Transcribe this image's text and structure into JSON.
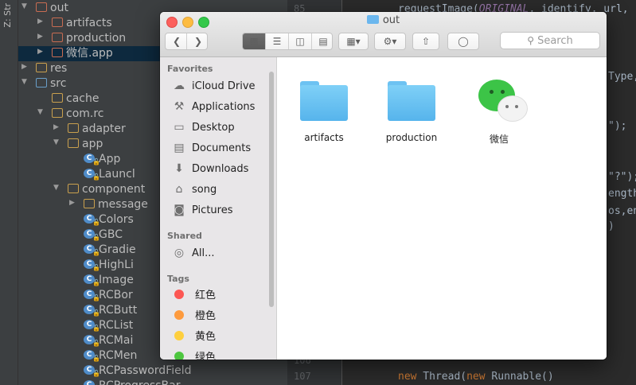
{
  "ide": {
    "side_label": "Z: Str",
    "tree": [
      {
        "label": "out",
        "depth": 1,
        "arrow": "▼",
        "icon": "folder-red"
      },
      {
        "label": "artifacts",
        "depth": 2,
        "arrow": "▶",
        "icon": "folder-red"
      },
      {
        "label": "production",
        "depth": 2,
        "arrow": "▶",
        "icon": "folder-red"
      },
      {
        "label": "微信.app",
        "depth": 2,
        "arrow": "▶",
        "icon": "folder-red",
        "selected": true
      },
      {
        "label": "res",
        "depth": 1,
        "arrow": "▶",
        "icon": "folder-res"
      },
      {
        "label": "src",
        "depth": 1,
        "arrow": "▼",
        "icon": "folder-blue"
      },
      {
        "label": "cache",
        "depth": 2,
        "arrow": "",
        "icon": "folder"
      },
      {
        "label": "com.rc",
        "depth": 2,
        "arrow": "▼",
        "icon": "folder"
      },
      {
        "label": "adapter",
        "depth": 3,
        "arrow": "▶",
        "icon": "folder"
      },
      {
        "label": "app",
        "depth": 3,
        "arrow": "▼",
        "icon": "folder"
      },
      {
        "label": "App",
        "depth": 4,
        "arrow": "",
        "icon": "class"
      },
      {
        "label": "Launcl",
        "depth": 4,
        "arrow": "",
        "icon": "class"
      },
      {
        "label": "component",
        "depth": 3,
        "arrow": "▼",
        "icon": "folder"
      },
      {
        "label": "message",
        "depth": 4,
        "arrow": "▶",
        "icon": "folder"
      },
      {
        "label": "Colors",
        "depth": 4,
        "arrow": "",
        "icon": "class"
      },
      {
        "label": "GBC",
        "depth": 4,
        "arrow": "",
        "icon": "class"
      },
      {
        "label": "Gradie",
        "depth": 4,
        "arrow": "",
        "icon": "class"
      },
      {
        "label": "HighLi",
        "depth": 4,
        "arrow": "",
        "icon": "class"
      },
      {
        "label": "Image",
        "depth": 4,
        "arrow": "",
        "icon": "class"
      },
      {
        "label": "RCBor",
        "depth": 4,
        "arrow": "",
        "icon": "class"
      },
      {
        "label": "RCButt",
        "depth": 4,
        "arrow": "",
        "icon": "class"
      },
      {
        "label": "RCList",
        "depth": 4,
        "arrow": "",
        "icon": "class"
      },
      {
        "label": "RCMai",
        "depth": 4,
        "arrow": "",
        "icon": "class"
      },
      {
        "label": "RCMen",
        "depth": 4,
        "arrow": "",
        "icon": "class"
      },
      {
        "label": "RCPasswordField",
        "depth": 4,
        "arrow": "",
        "icon": "class"
      },
      {
        "label": "RCProgressBar",
        "depth": 4,
        "arrow": "",
        "icon": "class"
      }
    ],
    "line_numbers": [
      "85",
      "106",
      "107"
    ],
    "code": {
      "l1_pre": "requestImage(",
      "l1_const": "ORIGINAL",
      "l1_post": ", identify, url,",
      "l2": "Type,",
      "l3": "\");",
      "l4": "\"?\");",
      "l5": "ength",
      "l6": "os,en",
      "l7": ")",
      "l8_kw1": "new",
      "l8_mid": " Thread(",
      "l8_kw2": "new",
      "l8_post": " Runnable()"
    }
  },
  "finder": {
    "title": "out",
    "search_placeholder": "Search",
    "sidebar": {
      "favorites_header": "Favorites",
      "favorites": [
        {
          "label": "iCloud Drive",
          "icon": "cloud-icon"
        },
        {
          "label": "Applications",
          "icon": "applications-icon"
        },
        {
          "label": "Desktop",
          "icon": "desktop-icon"
        },
        {
          "label": "Documents",
          "icon": "documents-icon"
        },
        {
          "label": "Downloads",
          "icon": "downloads-icon"
        },
        {
          "label": "song",
          "icon": "home-icon"
        },
        {
          "label": "Pictures",
          "icon": "camera-icon"
        }
      ],
      "shared_header": "Shared",
      "shared": [
        {
          "label": "All...",
          "icon": "network-icon"
        }
      ],
      "tags_header": "Tags",
      "tags": [
        {
          "label": "红色",
          "color": "#fc5753"
        },
        {
          "label": "橙色",
          "color": "#fd9a3d"
        },
        {
          "label": "黄色",
          "color": "#fecf3e"
        },
        {
          "label": "绿色",
          "color": "#4dc63f"
        }
      ]
    },
    "items": [
      {
        "name": "artifacts",
        "kind": "folder"
      },
      {
        "name": "production",
        "kind": "folder"
      },
      {
        "name": "微信",
        "kind": "app"
      }
    ]
  }
}
